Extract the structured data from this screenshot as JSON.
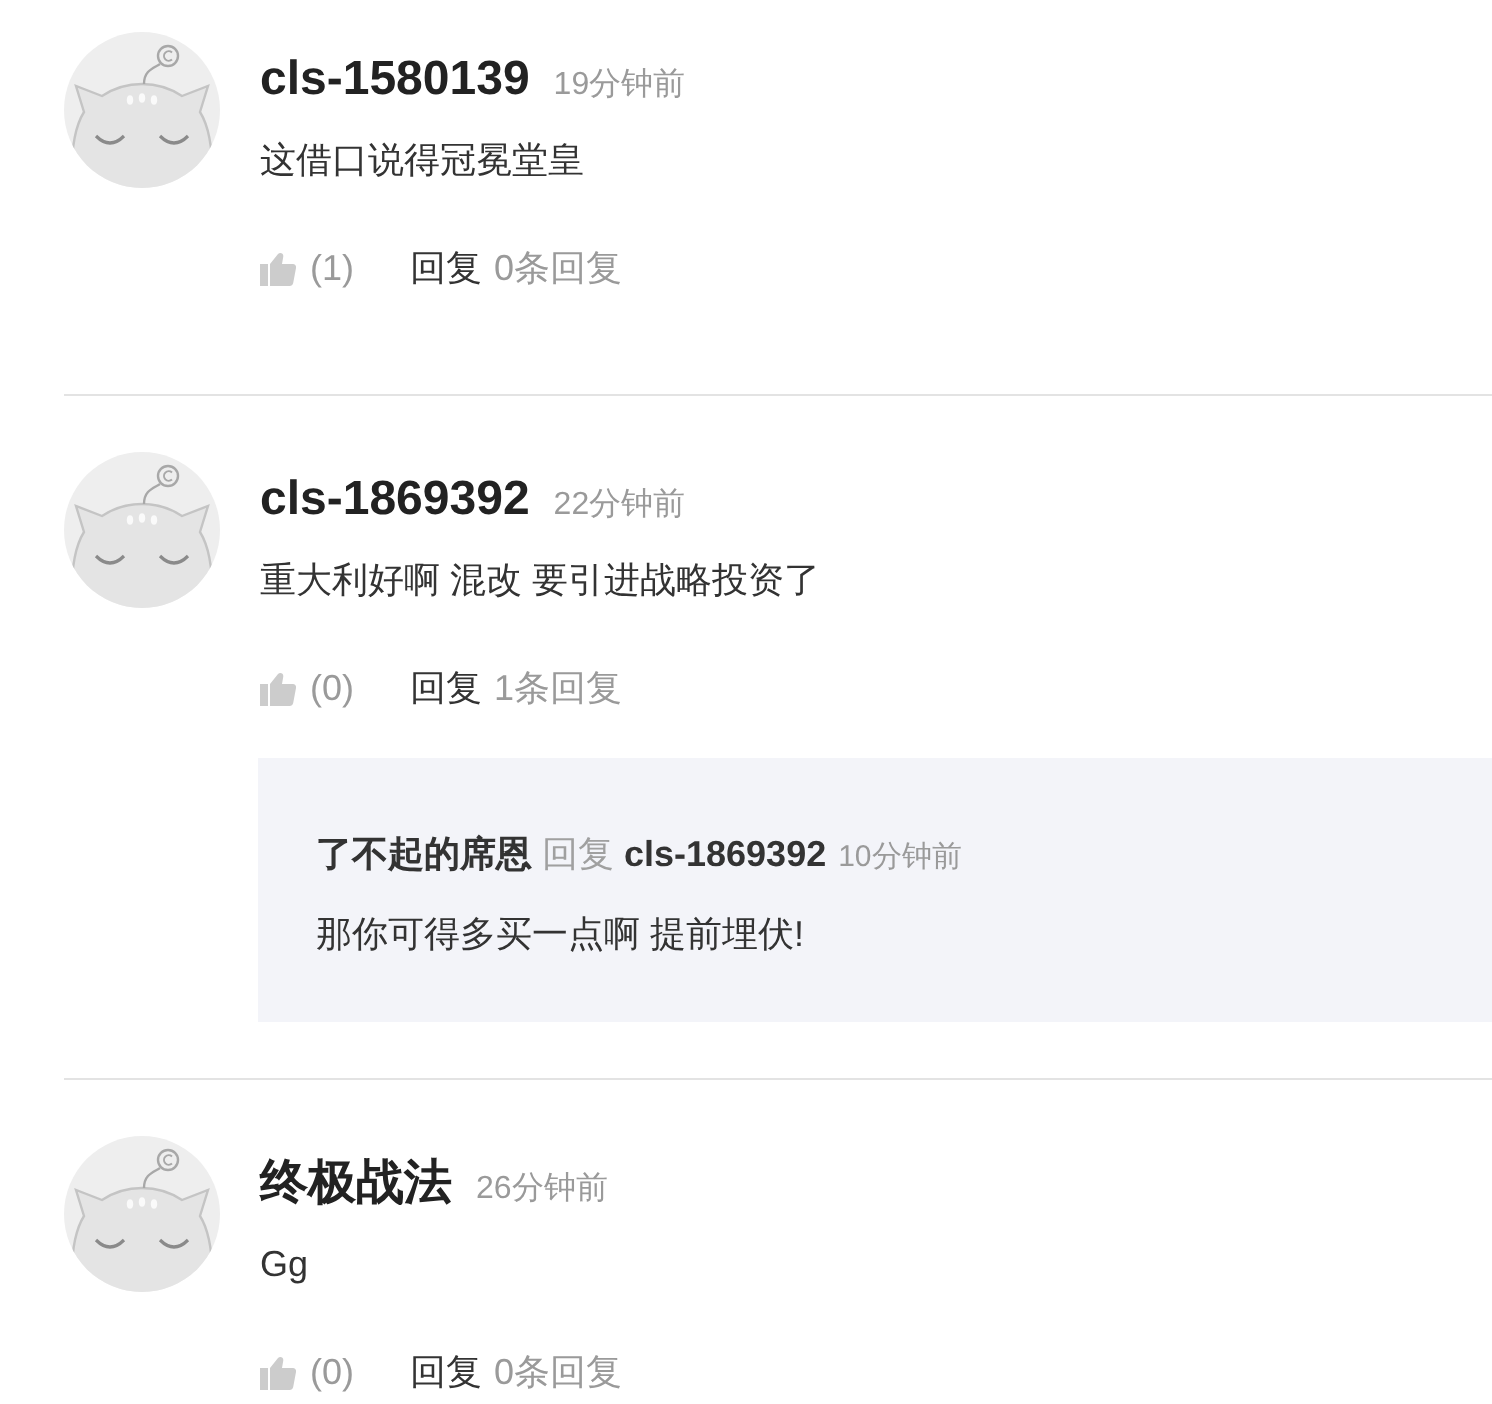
{
  "comments": [
    {
      "author": "cls-1580139",
      "time": "19分钟前",
      "text": "这借口说得冠冕堂皇",
      "likes": "(1)",
      "reply_action": "回复",
      "reply_count": "0条回复"
    },
    {
      "author": "cls-1869392",
      "time": "22分钟前",
      "text": "重大利好啊 混改 要引进战略投资了",
      "likes": "(0)",
      "reply_action": "回复",
      "reply_count": "1条回复",
      "replies": [
        {
          "author": "了不起的席恩",
          "verb": "回复",
          "target": "cls-1869392",
          "time": "10分钟前",
          "text": "那你可得多买一点啊 提前埋伏!"
        }
      ]
    },
    {
      "author": "终极战法",
      "time": "26分钟前",
      "text": "Gg",
      "likes": "(0)",
      "reply_action": "回复",
      "reply_count": "0条回复"
    }
  ]
}
